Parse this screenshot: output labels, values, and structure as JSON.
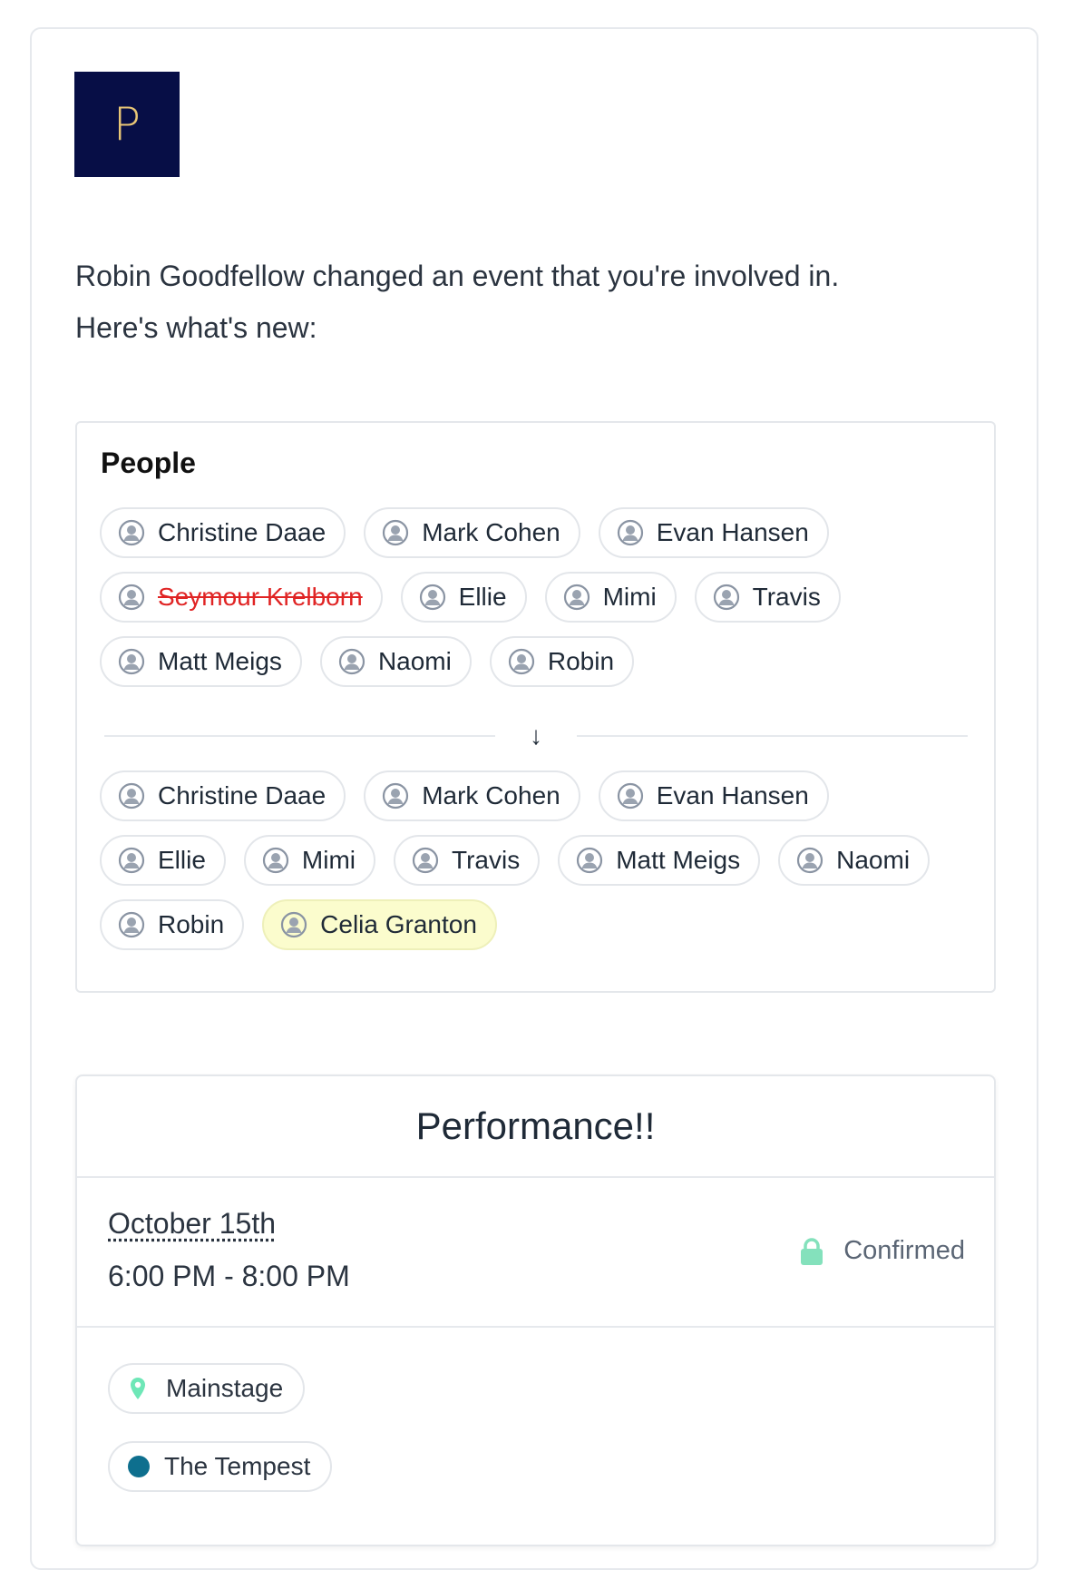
{
  "brand": {
    "logo_letter": "P",
    "logo_bg": "#070e46",
    "logo_fg": "#e8c676"
  },
  "intro": {
    "line1": "Robin Goodfellow changed an event that you're involved in.",
    "line2": "Here's what's new:"
  },
  "people": {
    "title": "People",
    "arrow": "↓",
    "before": [
      [
        "Christine Daae",
        "Mark Cohen",
        "Evan Hansen"
      ],
      [
        "Seymour Krelborn",
        "Ellie",
        "Mimi",
        "Travis"
      ],
      [
        "Matt Meigs",
        "Naomi",
        "Robin"
      ]
    ],
    "removed": [
      "Seymour Krelborn"
    ],
    "after": [
      [
        "Christine Daae",
        "Mark Cohen",
        "Evan Hansen"
      ],
      [
        "Ellie",
        "Mimi",
        "Travis",
        "Matt Meigs",
        "Naomi"
      ],
      [
        "Robin",
        "Celia Granton"
      ]
    ],
    "added": [
      "Celia Granton"
    ],
    "icon": "person-circle-icon"
  },
  "event": {
    "title": "Performance!!",
    "date": "October 15th",
    "time": "6:00 PM - 8:00 PM",
    "status": "Confirmed",
    "status_icon": "lock-icon",
    "status_color": "#84e1bc",
    "location": "Mainstage",
    "location_icon": "map-pin-icon",
    "production": "The Tempest",
    "production_color": "#0e6f8e"
  }
}
